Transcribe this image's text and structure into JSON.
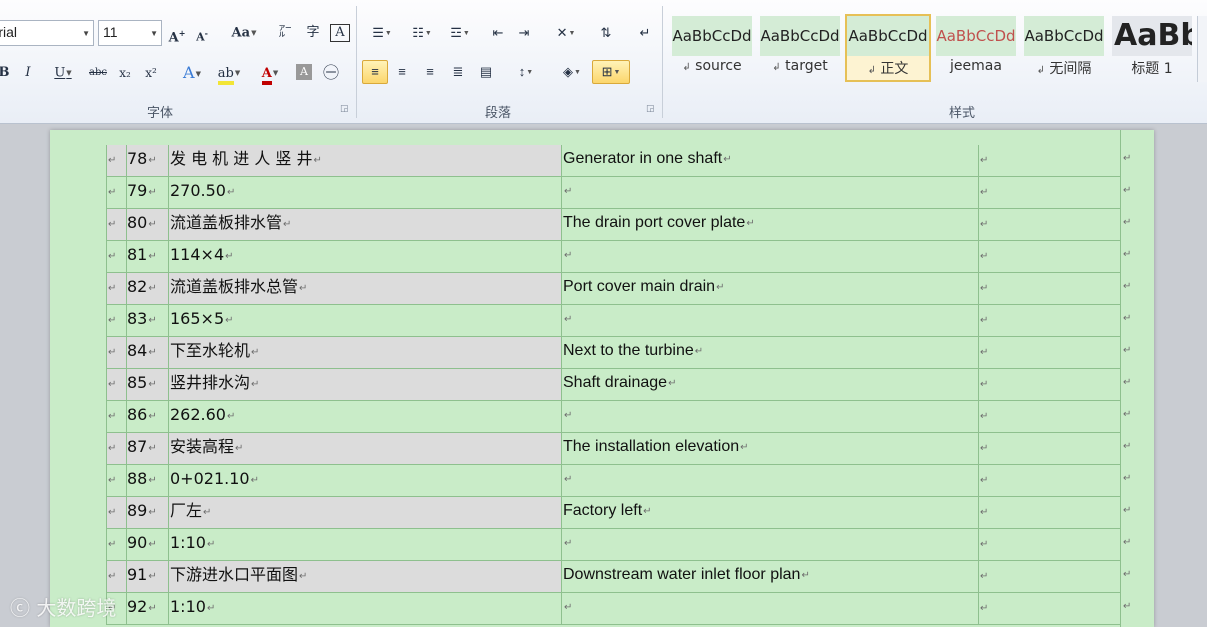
{
  "ribbon": {
    "font_group": {
      "label": "字体",
      "font_name": "Arial",
      "font_size": "11",
      "grow_font": "A",
      "shrink_font": "A",
      "change_case": "Aa",
      "bold": "B",
      "italic": "I",
      "underline": "U",
      "strike": "abc",
      "subscript": "x₂",
      "superscript": "x²"
    },
    "paragraph_group": {
      "label": "段落"
    },
    "styles_group": {
      "label": "样式",
      "items": [
        {
          "sample": "AaBbCcDd",
          "name": "source"
        },
        {
          "sample": "AaBbCcDd",
          "name": "target"
        },
        {
          "sample": "AaBbCcDd",
          "name": "正文"
        },
        {
          "sample": "AaBbCcDd",
          "name": "jeemaa"
        },
        {
          "sample": "AaBbCcDd",
          "name": "无间隔"
        },
        {
          "sample": "AaBb",
          "name": "标题 1"
        }
      ]
    }
  },
  "table": {
    "rows": [
      {
        "num": "78",
        "source": "发 电 机 进 人 竖 井",
        "target": "Generator in one shaft"
      },
      {
        "num": "79",
        "source": "270.50",
        "target": ""
      },
      {
        "num": "80",
        "source": "流道盖板排水管",
        "target": "The drain port cover plate"
      },
      {
        "num": "81",
        "source": "114×4",
        "target": ""
      },
      {
        "num": "82",
        "source": "流道盖板排水总管",
        "target": "Port cover main drain"
      },
      {
        "num": "83",
        "source": "165×5",
        "target": ""
      },
      {
        "num": "84",
        "source": "下至水轮机",
        "target": "Next to the turbine"
      },
      {
        "num": "85",
        "source": "竖井排水沟",
        "target": "Shaft drainage"
      },
      {
        "num": "86",
        "source": "262.60",
        "target": ""
      },
      {
        "num": "87",
        "source": "安装高程",
        "target": "The installation elevation"
      },
      {
        "num": "88",
        "source": "0+021.10",
        "target": ""
      },
      {
        "num": "89",
        "source": "厂左",
        "target": "Factory left"
      },
      {
        "num": "90",
        "source": "1:10",
        "target": ""
      },
      {
        "num": "91",
        "source": "下游进水口平面图",
        "target": "Downstream water inlet floor plan"
      },
      {
        "num": "92",
        "source": "1:10",
        "target": ""
      }
    ]
  },
  "watermark": {
    "text": "大数跨境"
  },
  "colors": {
    "doc_bg": "#c9ecc8",
    "gray_cell": "#dcdcdc",
    "grid": "#8ec08e",
    "highlight": "#fcd66c"
  }
}
